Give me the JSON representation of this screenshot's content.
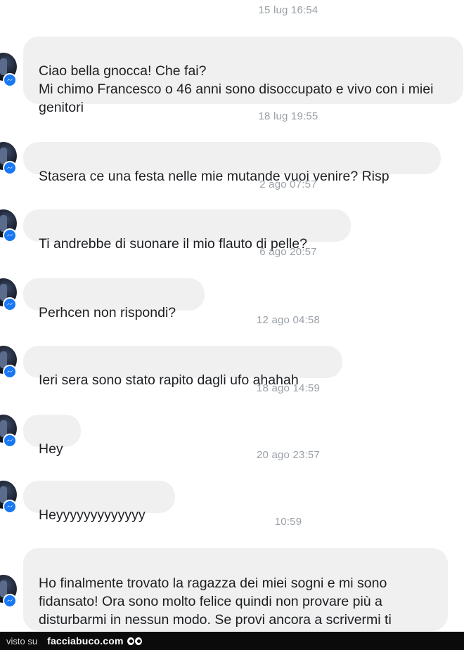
{
  "conversation": {
    "messages": [
      {
        "timestamp": "15 lug 16:54",
        "text": "Ciao bella gnocca! Che fai?\nMi chimo Francesco o 46 anni sono disoccupato e vivo con i miei genitori"
      },
      {
        "timestamp": "18 lug 19:55",
        "text": "Stasera ce una festa nelle mie mutande vuoi venire? Risp"
      },
      {
        "timestamp": "2 ago 07:57",
        "text": "Ti andrebbe di suonare il mio flauto di pelle?"
      },
      {
        "timestamp": "6 ago 20:57",
        "text": "Perhcen non rispondi?"
      },
      {
        "timestamp": "12 ago 04:58",
        "text": "Ieri sera sono stato rapito dagli ufo ahahah"
      },
      {
        "timestamp": "18 ago 14:59",
        "text": "Hey"
      },
      {
        "timestamp": "20 ago 23:57",
        "text": "Heyyyyyyyyyyyyy"
      },
      {
        "timestamp": "10:59",
        "text": "Ho finalmente trovato la ragazza dei miei sogni e mi sono fidansato! Ora sono molto felice quindi non provare più a disturbarmi in nessun modo. Se provi ancora a scrivermi ti blocco"
      }
    ]
  },
  "footer": {
    "prefix": "visto su",
    "brand": "facciabuco.com"
  },
  "colors": {
    "bubble": "#f0f0f0",
    "timestamp": "#9aa0a6",
    "messenger_badge": "#1877f2",
    "footer_bg": "#0b0b0b"
  },
  "icons": {
    "sender_avatar": "avatar",
    "badge": "messenger-icon",
    "footer_logo": "eyes-logo-icon"
  }
}
